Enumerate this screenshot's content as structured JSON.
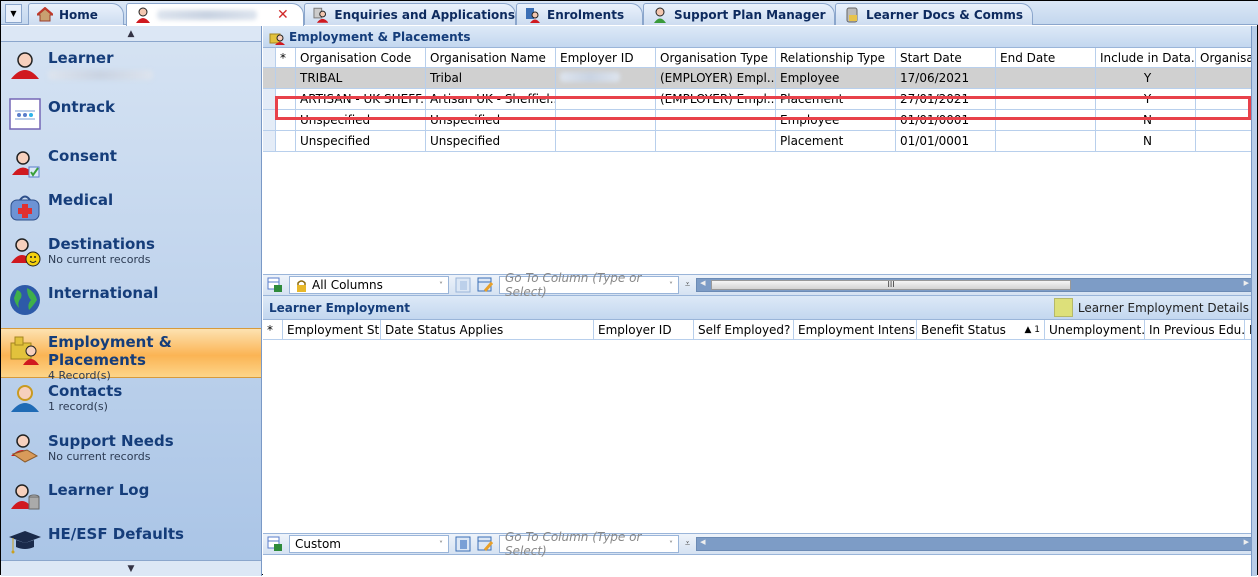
{
  "tabs": {
    "dropdown_icon": "triangle-down-icon",
    "items": [
      {
        "label": "Home",
        "icon": "home-icon"
      },
      {
        "label": "",
        "icon": "learner-icon",
        "active": true,
        "closable": true
      },
      {
        "label": "Enquiries and Applications",
        "icon": "enquiry-icon"
      },
      {
        "label": "Enrolments",
        "icon": "enrolments-icon"
      },
      {
        "label": "Support Plan Manager",
        "icon": "support-plan-icon"
      },
      {
        "label": "Learner Docs & Comms",
        "icon": "docs-icon"
      }
    ],
    "close_glyph": "✕"
  },
  "sidebar": {
    "scroll_up": "▲",
    "scroll_down": "▼",
    "items": [
      {
        "title": "Learner",
        "sub": ""
      },
      {
        "title": "Ontrack",
        "sub": ""
      },
      {
        "title": "Consent",
        "sub": ""
      },
      {
        "title": "Medical",
        "sub": ""
      },
      {
        "title": "Destinations",
        "sub": "No current records"
      },
      {
        "title": "International",
        "sub": ""
      },
      {
        "title": "Employment & Placements",
        "sub": "4 Record(s)",
        "active": true
      },
      {
        "title": "Contacts",
        "sub": "1 record(s)"
      },
      {
        "title": "Support Needs",
        "sub": "No current records"
      },
      {
        "title": "Learner Log",
        "sub": ""
      },
      {
        "title": "HE/ESF Defaults",
        "sub": ""
      }
    ]
  },
  "employment": {
    "title": "Employment & Placements",
    "columns": [
      "*",
      "Organisation Code",
      "Organisation Name",
      "Employer ID",
      "Organisation Type",
      "Relationship Type",
      "Start Date",
      "End Date",
      "Include in Data...",
      "Organisati"
    ],
    "rows": [
      [
        "",
        "TRIBAL",
        "Tribal",
        "",
        "(EMPLOYER) Empl...",
        "Employee",
        "17/06/2021",
        "",
        "Y",
        ""
      ],
      [
        "",
        "ARTISAN - UK SHEFF...",
        "Artisan UK - Sheffiel...",
        "",
        "(EMPLOYER) Empl...",
        "Placement",
        "27/01/2021",
        "",
        "Y",
        ""
      ],
      [
        "",
        "Unspecified",
        "Unspecified",
        "",
        "",
        "Employee",
        "01/01/0001",
        "",
        "N",
        ""
      ],
      [
        "",
        "Unspecified",
        "Unspecified",
        "",
        "",
        "Placement",
        "01/01/0001",
        "",
        "N",
        ""
      ]
    ],
    "toolbar": {
      "view_select": "All Columns",
      "goto_placeholder": "Go To Column (Type or Select)",
      "scroll_thumb": "III"
    }
  },
  "learner_employment": {
    "title": "Learner Employment",
    "legend_label": "Learner Employment Details",
    "legend_color": "#dde07a",
    "columns": [
      "*",
      "Employment St...",
      "Date Status Applies",
      "Employer ID",
      "Self Employed?",
      "Employment Intensity",
      "Benefit Status",
      "Unemployment...",
      "In Previous Edu...",
      "I"
    ],
    "sort_indicator": "▲ 1",
    "toolbar": {
      "view_select": "Custom",
      "goto_placeholder": "Go To Column (Type or Select)"
    }
  },
  "colors": {
    "highlight_border": "#e8414a",
    "active_sidebar": "#fbb454",
    "title_text": "#153d7a"
  }
}
